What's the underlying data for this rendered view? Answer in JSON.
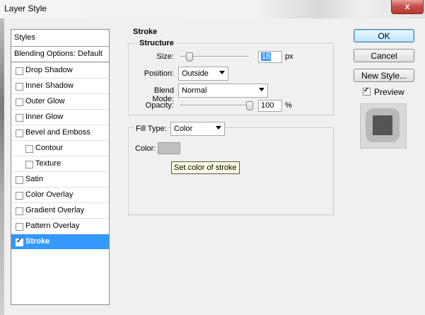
{
  "window": {
    "title": "Layer Style",
    "close_symbol": "x"
  },
  "styles_list": {
    "header": "Styles",
    "blending": "Blending Options: Default",
    "items": [
      {
        "label": "Drop Shadow",
        "checked": false,
        "indent": false
      },
      {
        "label": "Inner Shadow",
        "checked": false,
        "indent": false
      },
      {
        "label": "Outer Glow",
        "checked": false,
        "indent": false
      },
      {
        "label": "Inner Glow",
        "checked": false,
        "indent": false
      },
      {
        "label": "Bevel and Emboss",
        "checked": false,
        "indent": false
      },
      {
        "label": "Contour",
        "checked": false,
        "indent": true
      },
      {
        "label": "Texture",
        "checked": false,
        "indent": true
      },
      {
        "label": "Satin",
        "checked": false,
        "indent": false
      },
      {
        "label": "Color Overlay",
        "checked": false,
        "indent": false
      },
      {
        "label": "Gradient Overlay",
        "checked": false,
        "indent": false
      },
      {
        "label": "Pattern Overlay",
        "checked": false,
        "indent": false
      },
      {
        "label": "Stroke",
        "checked": true,
        "indent": false,
        "selected": true
      }
    ]
  },
  "stroke": {
    "section_title": "Stroke",
    "structure_title": "Structure",
    "size_label": "Size:",
    "size_value": "18",
    "size_unit": "px",
    "position_label": "Position:",
    "position_value": "Outside",
    "blend_label": "Blend Mode:",
    "blend_value": "Normal",
    "opacity_label": "Opacity:",
    "opacity_value": "100",
    "opacity_unit": "%",
    "filltype_label": "Fill Type:",
    "filltype_value": "Color",
    "color_label": "Color:",
    "color_swatch": "#bfbfbf",
    "tooltip": "Set color of stroke"
  },
  "buttons": {
    "ok": "OK",
    "cancel": "Cancel",
    "new_style": "New Style..."
  },
  "preview": {
    "label": "Preview",
    "checked": true
  }
}
